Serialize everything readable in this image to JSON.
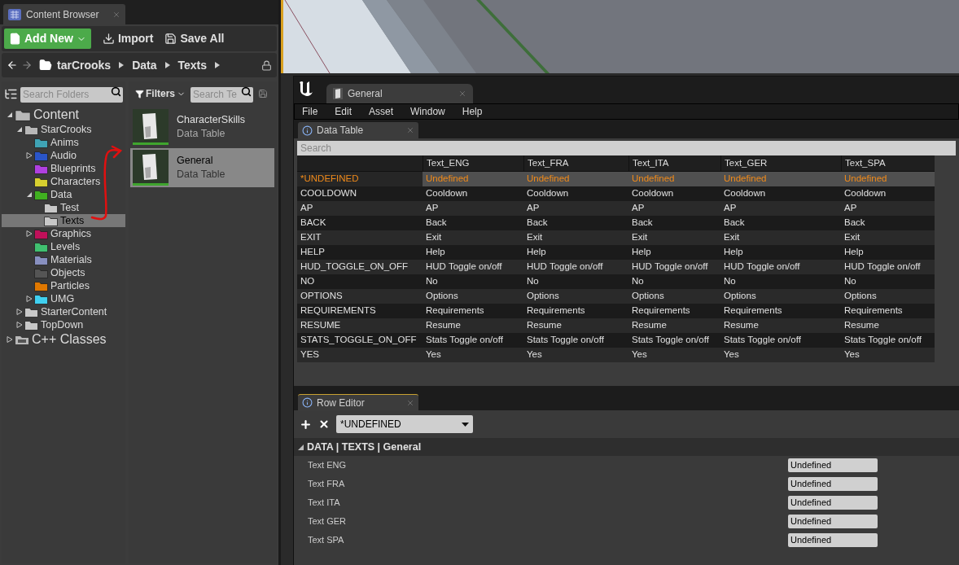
{
  "content_browser": {
    "tab": "Content Browser",
    "toolbar": [
      {
        "label": "Add New",
        "kind": "add"
      },
      {
        "label": "Import",
        "kind": "import"
      },
      {
        "label": "Save All",
        "kind": "save"
      }
    ],
    "path": [
      "tarCrooks",
      "Data",
      "Texts"
    ],
    "folder_search": {
      "placeholder": "Search Folders"
    },
    "filters": "Filters",
    "asset_search": {
      "placeholder": "Search Te"
    },
    "tree": [
      {
        "label": "Content",
        "kind": "root",
        "expanded": true,
        "selected": false,
        "children": [
          {
            "label": "StarCrooks",
            "color": "#b8b8b8",
            "expanded": true,
            "selected": false,
            "children": [
              {
                "label": "Anims",
                "color": "#3fa3b5",
                "selected": false
              },
              {
                "label": "Audio",
                "color": "#2a55c8",
                "expanded": false,
                "selected": false
              },
              {
                "label": "Blueprints",
                "color": "#b040e0",
                "selected": false
              },
              {
                "label": "Characters",
                "color": "#d8d030",
                "selected": false
              },
              {
                "label": "Data",
                "color": "#40b020",
                "expanded": true,
                "selected": false,
                "children": [
                  {
                    "label": "Test",
                    "color": "#c8c8c8",
                    "selected": false
                  },
                  {
                    "label": "Texts",
                    "color": "#c8c8c8",
                    "selected": true
                  }
                ]
              },
              {
                "label": "Graphics",
                "color": "#c0105a",
                "expanded": false,
                "selected": false
              },
              {
                "label": "Levels",
                "color": "#40c070",
                "selected": false
              },
              {
                "label": "Materials",
                "color": "#8890c0",
                "selected": false
              },
              {
                "label": "Objects",
                "color": "#555555",
                "selected": false
              },
              {
                "label": "Particles",
                "color": "#e07800",
                "selected": false
              },
              {
                "label": "UMG",
                "color": "#40d0f0",
                "expanded": false,
                "selected": false
              }
            ]
          },
          {
            "label": "StarterContent",
            "color": "#c8c8c8",
            "expanded": false,
            "selected": false
          },
          {
            "label": "TopDown",
            "color": "#c8c8c8",
            "expanded": false,
            "selected": false
          }
        ]
      },
      {
        "label": "C++ Classes",
        "kind": "code",
        "expanded": false,
        "selected": false
      }
    ],
    "assets": [
      {
        "name": "CharacterSkills",
        "type": "Data Table",
        "selected": false
      },
      {
        "name": "General",
        "type": "Data Table",
        "selected": true
      }
    ]
  },
  "editor": {
    "tab": "General",
    "menu": [
      "File",
      "Edit",
      "Asset",
      "Window",
      "Help"
    ],
    "data_table": {
      "tab": "Data Table",
      "search": {
        "placeholder": "Search"
      },
      "columns": [
        "Text_ENG",
        "Text_FRA",
        "Text_ITA",
        "Text_GER",
        "Text_SPA"
      ],
      "rows": [
        {
          "name": "*UNDEFINED",
          "values": [
            "Undefined",
            "Undefined",
            "Undefined",
            "Undefined",
            "Undefined"
          ],
          "selected": true
        },
        {
          "name": "COOLDOWN",
          "values": [
            "Cooldown",
            "Cooldown",
            "Cooldown",
            "Cooldown",
            "Cooldown"
          ],
          "selected": false
        },
        {
          "name": "AP",
          "values": [
            "AP",
            "AP",
            "AP",
            "AP",
            "AP"
          ],
          "selected": false
        },
        {
          "name": "BACK",
          "values": [
            "Back",
            "Back",
            "Back",
            "Back",
            "Back"
          ],
          "selected": false
        },
        {
          "name": "EXIT",
          "values": [
            "Exit",
            "Exit",
            "Exit",
            "Exit",
            "Exit"
          ],
          "selected": false
        },
        {
          "name": "HELP",
          "values": [
            "Help",
            "Help",
            "Help",
            "Help",
            "Help"
          ],
          "selected": false
        },
        {
          "name": "HUD_TOGGLE_ON_OFF",
          "values": [
            "HUD Toggle on/off",
            "HUD Toggle on/off",
            "HUD Toggle on/off",
            "HUD Toggle on/off",
            "HUD Toggle on/off"
          ],
          "selected": false
        },
        {
          "name": "NO",
          "values": [
            "No",
            "No",
            "No",
            "No",
            "No"
          ],
          "selected": false
        },
        {
          "name": "OPTIONS",
          "values": [
            "Options",
            "Options",
            "Options",
            "Options",
            "Options"
          ],
          "selected": false
        },
        {
          "name": "REQUIREMENTS",
          "values": [
            "Requirements",
            "Requirements",
            "Requirements",
            "Requirements",
            "Requirements"
          ],
          "selected": false
        },
        {
          "name": "RESUME",
          "values": [
            "Resume",
            "Resume",
            "Resume",
            "Resume",
            "Resume"
          ],
          "selected": false
        },
        {
          "name": "STATS_TOGGLE_ON_OFF",
          "values": [
            "Stats Toggle on/off",
            "Stats Toggle on/off",
            "Stats Toggle on/off",
            "Stats Toggle on/off",
            "Stats Toggle on/off"
          ],
          "selected": false
        },
        {
          "name": "YES",
          "values": [
            "Yes",
            "Yes",
            "Yes",
            "Yes",
            "Yes"
          ],
          "selected": false
        }
      ]
    },
    "row_editor": {
      "tab": "Row Editor",
      "row": "*UNDEFINED",
      "category": "DATA | TEXTS | General",
      "fields": [
        {
          "label": "Text ENG",
          "value": "Undefined"
        },
        {
          "label": "Text FRA",
          "value": "Undefined"
        },
        {
          "label": "Text ITA",
          "value": "Undefined"
        },
        {
          "label": "Text GER",
          "value": "Undefined"
        },
        {
          "label": "Text SPA",
          "value": "Undefined"
        }
      ]
    }
  }
}
